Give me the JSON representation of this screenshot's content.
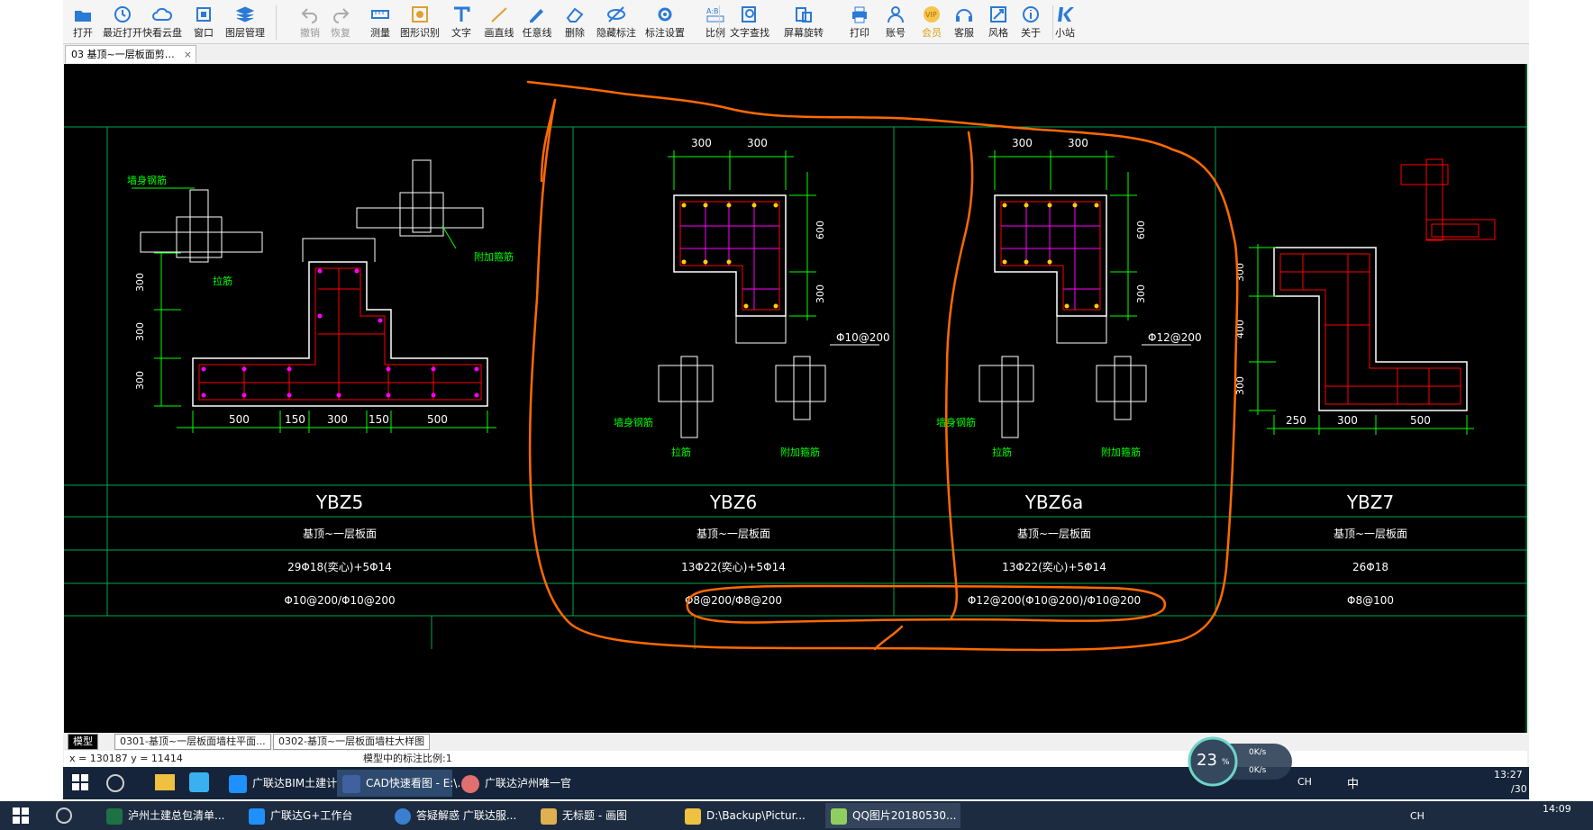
{
  "toolbar": {
    "items": [
      {
        "label": "打开",
        "icon": "folder-open-icon"
      },
      {
        "label": "最近打开",
        "icon": "recent-clock-icon"
      },
      {
        "label": "快看云盘",
        "icon": "cloud-icon"
      },
      {
        "label": "窗口",
        "icon": "window-icon"
      },
      {
        "label": "图层管理",
        "icon": "layers-icon"
      },
      {
        "label": "撤销",
        "icon": "undo-icon"
      },
      {
        "label": "恢复",
        "icon": "redo-icon"
      },
      {
        "label": "测量",
        "icon": "measure-icon"
      },
      {
        "label": "图形识别",
        "icon": "shape-recognize-icon"
      },
      {
        "label": "文字",
        "icon": "text-icon"
      },
      {
        "label": "画直线",
        "icon": "line-icon"
      },
      {
        "label": "任意线",
        "icon": "freehand-icon"
      },
      {
        "label": "删除",
        "icon": "eraser-icon"
      },
      {
        "label": "隐藏标注",
        "icon": "hide-annotation-icon"
      },
      {
        "label": "标注设置",
        "icon": "annotation-settings-icon"
      },
      {
        "label": "比例",
        "icon": "scale-icon"
      },
      {
        "label": "文字查找",
        "icon": "text-search-icon"
      },
      {
        "label": "屏幕旋转",
        "icon": "rotate-screen-icon"
      },
      {
        "label": "打印",
        "icon": "printer-icon"
      },
      {
        "label": "账号",
        "icon": "account-icon"
      },
      {
        "label": "会员",
        "icon": "vip-icon"
      },
      {
        "label": "客服",
        "icon": "headset-icon"
      },
      {
        "label": "风格",
        "icon": "style-icon"
      },
      {
        "label": "关于",
        "icon": "info-icon"
      },
      {
        "label": "小站",
        "icon": "k-logo-icon"
      }
    ]
  },
  "doc_tab": {
    "label": "03 基顶~一层板面剪…",
    "close": "×"
  },
  "drawing": {
    "names": [
      "YBZ5",
      "YBZ6",
      "YBZ6a",
      "YBZ7"
    ],
    "elevation": [
      "基顶~一层板面",
      "基顶~一层板面",
      "基顶~一层板面",
      "基顶~一层板面"
    ],
    "longitudinal": [
      "29Φ18(奕心)+5Φ14",
      "13Φ22(奕心)+5Φ14",
      "13Φ22(奕心)+5Φ14",
      "26Φ18"
    ],
    "stirrup": [
      "Φ10@200/Φ10@200",
      "Φ8@200/Φ8@200",
      "Φ12@200(Φ10@200)/Φ10@200",
      "Φ8@100"
    ],
    "labels": {
      "wall_rebar": "墙身钢筋",
      "tie": "拉筋",
      "extra_tie": "附加箍筋",
      "dim300": "300",
      "dim150": "150",
      "dim500": "500",
      "dim600": "600",
      "dim400": "400",
      "dim250": "250",
      "ybz6_side": "Φ10@200",
      "ybz6a_side": "Φ12@200"
    }
  },
  "layout_tabs": [
    "模型",
    "0301-基顶~一层板面墙柱平面...",
    "0302-基顶~一层板面墙柱大样图"
  ],
  "status": {
    "coords": "x = 130187  y = 11414",
    "scale": "模型中的标注比例:1"
  },
  "inner_taskbar": {
    "items": [
      "广联达BIM土建计...",
      "CAD快速看图 - E:\\...",
      "广联达泸州唯一官"
    ],
    "tray_lang": "CH",
    "tray_ime": "中",
    "time": "13:27",
    "date": "/30"
  },
  "speed_widget": {
    "percent": "23",
    "unit": "%",
    "up": "0K/s",
    "down": "0K/s"
  },
  "outer_taskbar": {
    "items": [
      "泸州土建总包清单...",
      "广联达G+工作台",
      "答疑解惑 广联达服...",
      "无标题 - 画图",
      "D:\\Backup\\Pictur...",
      "QQ图片20180530..."
    ],
    "tray_lang": "CH",
    "time": "14:09"
  },
  "colors": {
    "canvas": "#000000",
    "grid_line": "#00a651",
    "dim_green": "#00ff00",
    "concrete": "#ffffff",
    "rebar_red": "#ff0000",
    "rebar_magenta": "#ff00ff",
    "annotation_orange": "#ff6a00",
    "text_white": "#ffffff"
  }
}
